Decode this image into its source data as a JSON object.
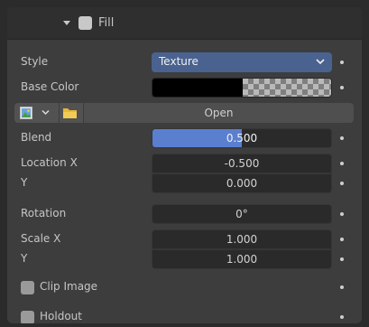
{
  "header": {
    "title": "Fill",
    "expanded": true,
    "enabled": false
  },
  "style": {
    "label": "Style",
    "value": "Texture"
  },
  "base_color": {
    "label": "Base Color",
    "color": "#000000"
  },
  "image": {
    "open_label": "Open"
  },
  "blend": {
    "label": "Blend",
    "value": "0.500",
    "fraction": 0.5
  },
  "location": {
    "x_label": "Location X",
    "x_value": "-0.500",
    "y_label": "Y",
    "y_value": "0.000"
  },
  "rotation": {
    "label": "Rotation",
    "value": "0°"
  },
  "scale": {
    "x_label": "Scale X",
    "x_value": "1.000",
    "y_label": "Y",
    "y_value": "1.000"
  },
  "clip_image": {
    "label": "Clip Image",
    "checked": false
  },
  "holdout": {
    "label": "Holdout",
    "checked": false
  },
  "colors": {
    "accent": "#5b7fcf",
    "select_bg": "#4a628f",
    "panel_bg": "#3d3d3d",
    "field_bg": "#2a2a2a"
  },
  "icons": [
    "chevron-down-icon",
    "checkbox-icon",
    "image-icon",
    "dropdown-arrow-icon",
    "folder-icon",
    "animate-dot-icon"
  ]
}
